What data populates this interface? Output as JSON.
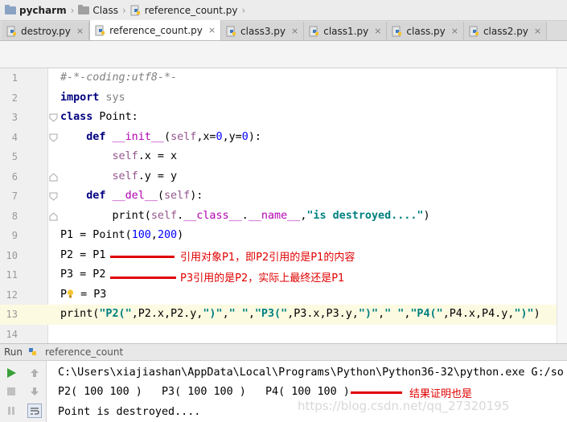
{
  "breadcrumb": [
    {
      "label": "pycharm",
      "icon": "folder-icon"
    },
    {
      "label": "Class",
      "icon": "folder-icon"
    },
    {
      "label": "reference_count.py",
      "icon": "python-file-icon"
    }
  ],
  "tabs": [
    {
      "label": "destroy.py",
      "active": false
    },
    {
      "label": "reference_count.py",
      "active": true
    },
    {
      "label": "class3.py",
      "active": false
    },
    {
      "label": "class1.py",
      "active": false
    },
    {
      "label": "class.py",
      "active": false
    },
    {
      "label": "class2.py",
      "active": false
    }
  ],
  "tab_close_glyph": "×",
  "code": {
    "line_numbers": [
      "1",
      "2",
      "3",
      "4",
      "5",
      "6",
      "7",
      "8",
      "9",
      "10",
      "11",
      "12",
      "13",
      "14"
    ],
    "l1_comment": "#-*-coding:utf8-*-",
    "l2_kw": "import",
    "l2_mod": " sys",
    "l3_kw": "class",
    "l3_name": " Point:",
    "l4_kw": "def",
    "l4_fn": "__init__",
    "l4_open": "(",
    "l4_self": "self",
    "l4_a": ",x=",
    "l4_n1": "0",
    "l4_b": ",y=",
    "l4_n2": "0",
    "l4_close": "):",
    "l5_self": "self",
    "l5_rest": ".x = x",
    "l6_self": "self",
    "l6_rest": ".y = y",
    "l7_kw": "def",
    "l7_fn": "__del__",
    "l7_open": "(",
    "l7_self": "self",
    "l7_close": "):",
    "l8_print": "print(",
    "l8_self": "self",
    "l8_dot": ".",
    "l8_class": "__class__",
    "l8_dot2": ".",
    "l8_name": "__name__",
    "l8_comma": ",",
    "l8_str": "\"is destroyed....\"",
    "l8_close": ")",
    "l9_a": "P1 = Point(",
    "l9_n1": "100",
    "l9_comma": ",",
    "l9_n2": "200",
    "l9_close": ")",
    "l10": "P2 = P1",
    "l11": "P3 = P2",
    "l12_a": "P",
    "l12_b": " = P3",
    "l13_print": "print(",
    "l13_s1": "\"P2(\"",
    "l13_m1": ",P2.x,P2.y,",
    "l13_s2": "\")\"",
    "l13_c1": ",",
    "l13_s3": "\" \"",
    "l13_c2": ",",
    "l13_s4": "\"P3(\"",
    "l13_m2": ",P3.x,P3.y,",
    "l13_s5": "\")\"",
    "l13_c3": ",",
    "l13_s6": "\" \"",
    "l13_c4": ",",
    "l13_s7": "\"P4(\"",
    "l13_m3": ",P4.x,P4.y,",
    "l13_s8": "\")\"",
    "l13_close": ")"
  },
  "annotations": {
    "line10": "引用对象P1，即P2引用的是P1的内容",
    "line11": "P3引用的是P2，实际上最终还是P1",
    "output": "结果证明也是"
  },
  "run": {
    "label": "Run",
    "config": "reference_count",
    "command": "C:\\Users\\xiajiashan\\AppData\\Local\\Programs\\Python\\Python36-32\\python.exe G:/so",
    "output1": "P2( 100 100 )   P3( 100 100 )   P4( 100 100 )",
    "output2": "Point is destroyed...."
  },
  "watermark": "https://blog.csdn.net/qq_27320195",
  "colors": {
    "keyword": "#000080",
    "string": "#008080",
    "annotation": "#e00000",
    "number": "#0000ff"
  }
}
